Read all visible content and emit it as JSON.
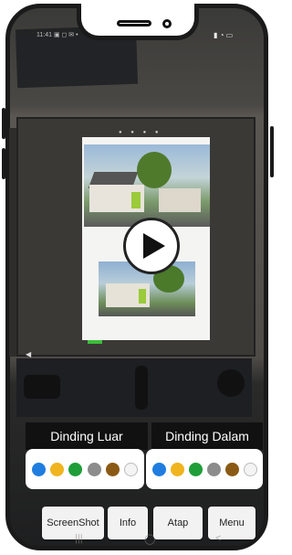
{
  "status_bar": {
    "left": "11:41 ▣ ◻ ✉ •",
    "right": "▮ ◔ ▭"
  },
  "wall_panels": [
    {
      "label": "Dinding Luar",
      "colors": [
        "#1f7de0",
        "#f0b41e",
        "#1e9e38",
        "#8c8c8c",
        "#8a5a14",
        "#f4f4f4"
      ]
    },
    {
      "label": "Dinding Dalam",
      "colors": [
        "#1f7de0",
        "#f0b41e",
        "#1e9e38",
        "#8c8c8c",
        "#8a5a14",
        "#f4f4f4"
      ]
    }
  ],
  "toolbar": {
    "screenshot_label": "ScreenShot",
    "info_label": "Info",
    "atap_label": "Atap",
    "menu_label": "Menu"
  },
  "nav": {
    "recents": "|||",
    "home": "◯",
    "back": "<"
  },
  "icons": {
    "play": "play-icon"
  }
}
